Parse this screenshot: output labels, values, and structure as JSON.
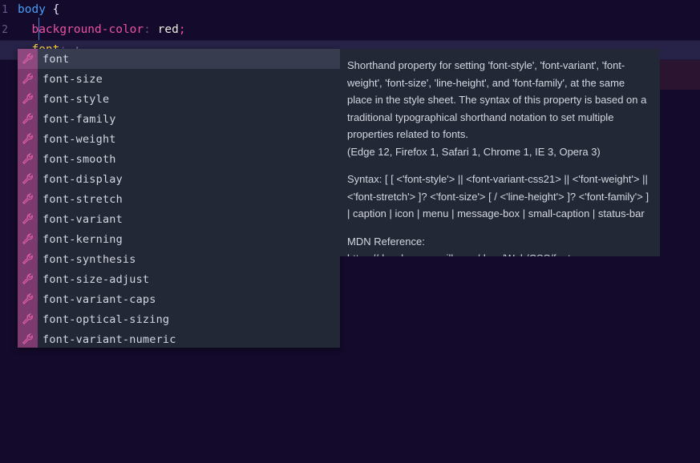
{
  "editor": {
    "background_color": "#140a2b",
    "lines": [
      {
        "number": "1",
        "active": false,
        "tokens": [
          {
            "text": "body",
            "cls": "tok-sel"
          },
          {
            "text": " ",
            "cls": "tok-plain"
          },
          {
            "text": "{",
            "cls": "tok-brace"
          }
        ]
      },
      {
        "number": "2",
        "active": false,
        "tokens": [
          {
            "text": "  ",
            "cls": "tok-plain"
          },
          {
            "text": "background-color",
            "cls": "tok-prop"
          },
          {
            "text": ":",
            "cls": "tok-punc"
          },
          {
            "text": " ",
            "cls": "tok-plain"
          },
          {
            "text": "red",
            "cls": "tok-val"
          },
          {
            "text": ";",
            "cls": "tok-prop"
          }
        ]
      },
      {
        "number": "3",
        "active": true,
        "tokens": [
          {
            "text": "  ",
            "cls": "tok-plain"
          },
          {
            "text": "font",
            "cls": "tok-prop2"
          },
          {
            "text": ":",
            "cls": "tok-punc"
          },
          {
            "text": " ",
            "cls": "tok-plain"
          },
          {
            "text": ";",
            "cls": "tok-semi"
          }
        ]
      }
    ]
  },
  "suggest": {
    "selected_index": 0,
    "icon_name": "property-wrench-icon",
    "items": [
      {
        "label": "font"
      },
      {
        "label": "font-size"
      },
      {
        "label": "font-style"
      },
      {
        "label": "font-family"
      },
      {
        "label": "font-weight"
      },
      {
        "label": "font-smooth"
      },
      {
        "label": "font-display"
      },
      {
        "label": "font-stretch"
      },
      {
        "label": "font-variant"
      },
      {
        "label": "font-kerning"
      },
      {
        "label": "font-synthesis"
      },
      {
        "label": "font-size-adjust"
      },
      {
        "label": "font-variant-caps"
      },
      {
        "label": "font-optical-sizing"
      },
      {
        "label": "font-variant-numeric"
      }
    ]
  },
  "documentation": {
    "description": "Shorthand property for setting 'font-style', 'font-variant', 'font-weight', 'font-size', 'line-height', and 'font-family', at the same place in the style sheet. The syntax of this property is based on a traditional typographical shorthand notation to set multiple properties related to fonts.",
    "browser_support": "(Edge 12, Firefox 1, Safari 1, Chrome 1, IE 3, Opera 3)",
    "syntax": "Syntax: [ [ <'font-style'> || <font-variant-css21> || <'font-weight'> || <'font-stretch'> ]? <'font-size'> [ / <'line-height'> ]? <'font-family'> ] | caption | icon | menu | message-box | small-caption | status-bar",
    "reference": "MDN Reference: https://developer.mozilla.org/docs/Web/CSS/font"
  },
  "colors": {
    "editor_bg": "#140a2b",
    "current_line_bg": "#272248",
    "widget_bg": "#232836",
    "selected_row_bg": "#373d4e",
    "icon_bg": "#7c3a6e",
    "icon_stroke": "#e060a8",
    "selector_color": "#4a9cf5",
    "property_color": "#e952a0",
    "active_property_color": "#ffd23f"
  }
}
